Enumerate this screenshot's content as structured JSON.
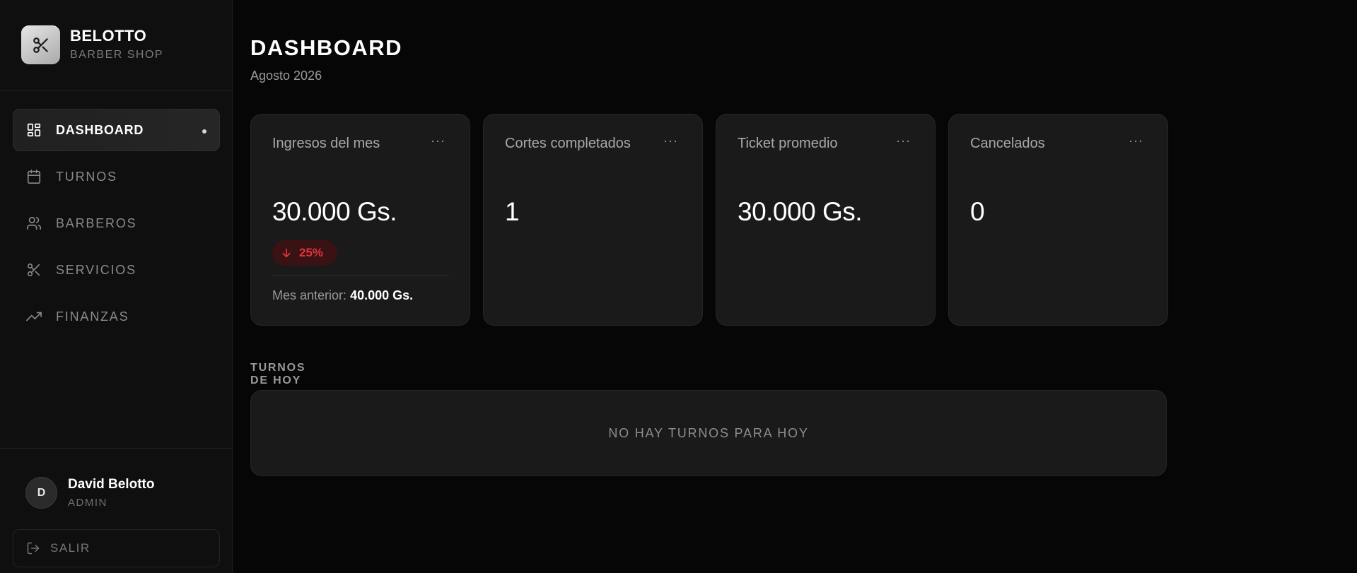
{
  "brand": {
    "name": "BELOTTO",
    "subtitle": "BARBER SHOP",
    "logo_icon": "scissors-icon"
  },
  "sidebar": {
    "items": [
      {
        "label": "DASHBOARD",
        "icon": "dashboard-grid-icon",
        "active": true
      },
      {
        "label": "TURNOS",
        "icon": "calendar-icon",
        "active": false
      },
      {
        "label": "BARBEROS",
        "icon": "users-icon",
        "active": false
      },
      {
        "label": "SERVICIOS",
        "icon": "scissors-icon",
        "active": false
      },
      {
        "label": "FINANZAS",
        "icon": "trending-up-icon",
        "active": false
      }
    ]
  },
  "user": {
    "initial": "D",
    "name": "David Belotto",
    "role": "ADMIN"
  },
  "logout": {
    "label": "SALIR",
    "icon": "logout-icon"
  },
  "header": {
    "title": "DASHBOARD",
    "subtitle": "Agosto 2026"
  },
  "cards": [
    {
      "title": "Ingresos del mes",
      "value": "30.000 Gs.",
      "more": "···",
      "change": {
        "direction": "down",
        "value": "25%"
      },
      "footer_label": "Mes anterior:",
      "footer_value": "40.000 Gs."
    },
    {
      "title": "Cortes completados",
      "value": "1",
      "more": "···"
    },
    {
      "title": "Ticket promedio",
      "value": "30.000 Gs.",
      "more": "···"
    },
    {
      "title": "Cancelados",
      "value": "0",
      "more": "···"
    }
  ],
  "today": {
    "label": "TURNOS DE HOY",
    "empty_text": "NO HAY TURNOS PARA HOY"
  },
  "colors": {
    "background": "#060606",
    "sidebar": "#0f0f0f",
    "card": "#1a1a1a",
    "negative": "#e0353d",
    "negative_bg": "#3a1214"
  }
}
